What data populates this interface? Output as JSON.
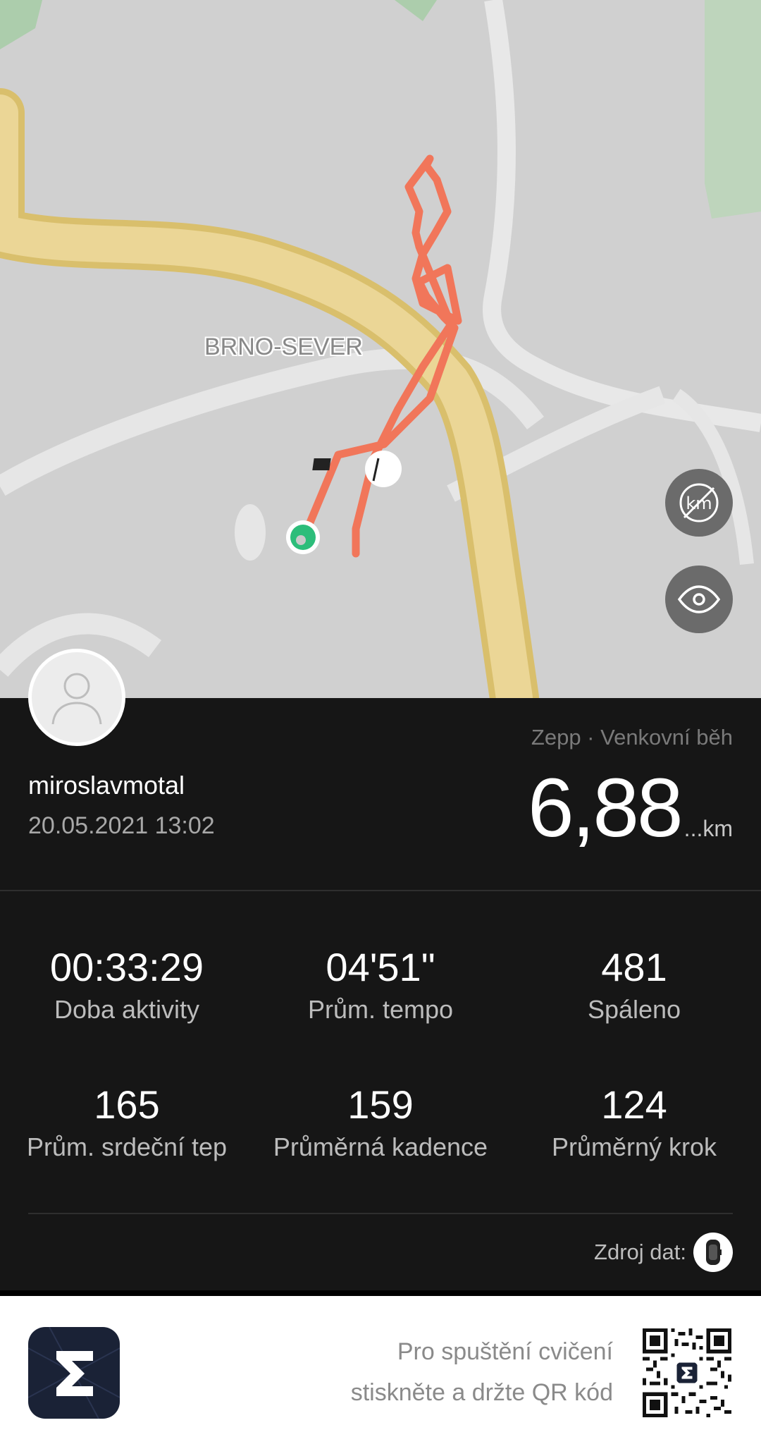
{
  "map": {
    "district_label": "BRNO-SEVER",
    "buttons": [
      {
        "name": "km-markers-toggle",
        "icon": "km-markers-off-icon"
      },
      {
        "name": "visibility-toggle",
        "icon": "eye-icon"
      }
    ],
    "route_color": "#f1765a",
    "start_marker_color": "#2dbd7a"
  },
  "profile": {
    "username": "miroslavmotal",
    "datetime": "20.05.2021 13:02",
    "avatar_icon": "person-icon"
  },
  "workout": {
    "source_title": "Zepp · Venkovní běh",
    "distance_value": "6,88",
    "distance_unit": "...km"
  },
  "stats": [
    {
      "value": "00:33:29",
      "label": "Doba aktivity"
    },
    {
      "value": "04'51\"",
      "label": "Prům. tempo"
    },
    {
      "value": "481",
      "label": "Spáleno"
    },
    {
      "value": "165",
      "label": "Prům. srdeční tep"
    },
    {
      "value": "159",
      "label": "Průměrná kadence"
    },
    {
      "value": "124",
      "label": "Průměrný krok"
    }
  ],
  "data_source": {
    "label": "Zdroj dat:",
    "icon": "watch-device-icon"
  },
  "footer": {
    "app_icon": "zepp-sigma-icon",
    "qr_text_line1": "Pro spuštění cvičení",
    "qr_text_line2": "stiskněte a držte QR kód",
    "qr_icon": "qr-code-icon"
  }
}
